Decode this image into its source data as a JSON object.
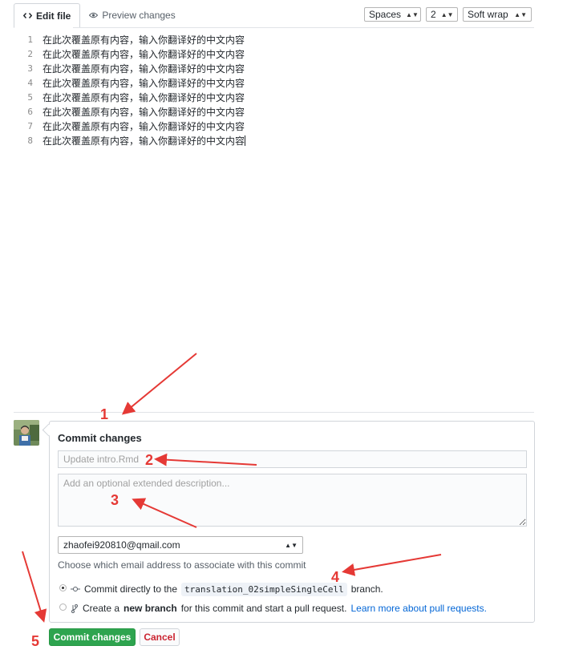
{
  "tabs": {
    "edit": "Edit file",
    "preview": "Preview changes"
  },
  "editor_options": {
    "indent_mode": "Spaces",
    "indent_size": "2",
    "wrap_mode": "Soft wrap"
  },
  "editor": {
    "lines": [
      {
        "n": "1",
        "text": "在此次覆盖原有内容，输入你翻译好的中文内容"
      },
      {
        "n": "2",
        "text": "在此次覆盖原有内容，输入你翻译好的中文内容"
      },
      {
        "n": "3",
        "text": "在此次覆盖原有内容，输入你翻译好的中文内容"
      },
      {
        "n": "4",
        "text": "在此次覆盖原有内容，输入你翻译好的中文内容"
      },
      {
        "n": "5",
        "text": "在此次覆盖原有内容，输入你翻译好的中文内容"
      },
      {
        "n": "6",
        "text": "在此次覆盖原有内容，输入你翻译好的中文内容"
      },
      {
        "n": "7",
        "text": "在此次覆盖原有内容，输入你翻译好的中文内容"
      },
      {
        "n": "8",
        "text": "在此次覆盖原有内容，输入你翻译好的中文内容"
      }
    ]
  },
  "commit": {
    "title": "Commit changes",
    "summary_placeholder": "Update intro.Rmd",
    "description_placeholder": "Add an optional extended description...",
    "email": "zhaofei920810@qmail.com",
    "email_note": "Choose which email address to associate with this commit",
    "option_direct_prefix": "Commit directly to the",
    "branch": "translation_02simpleSingleCell",
    "option_direct_suffix": "branch.",
    "option_new_prefix": "Create a",
    "option_new_bold": "new branch",
    "option_new_suffix": "for this commit and start a pull request.",
    "learn_more": "Learn more about pull requests.",
    "commit_button": "Commit changes",
    "cancel_button": "Cancel"
  },
  "annotations": {
    "n1": "1",
    "n2": "2",
    "n3": "3",
    "n4": "4",
    "n5": "5"
  },
  "colors": {
    "commit_green": "#2ea44f",
    "annotation_red": "#e53935",
    "link_blue": "#0366d6",
    "cancel_red": "#cb2431"
  },
  "icons": [
    "code-icon",
    "eye-icon",
    "git-commit-icon",
    "git-branch-icon",
    "avatar"
  ]
}
